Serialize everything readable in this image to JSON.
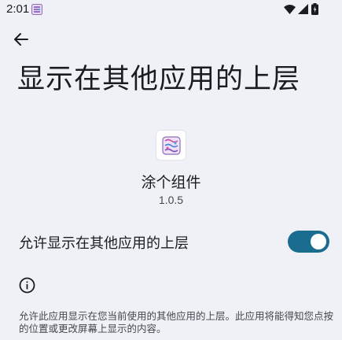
{
  "status_bar": {
    "time": "2:01",
    "icons": [
      "app-notification-icon",
      "wifi-icon",
      "signal-icon",
      "battery-icon"
    ]
  },
  "header": {
    "title": "显示在其他应用的上层",
    "back_icon": "arrow-back-icon"
  },
  "app": {
    "name": "涂个组件",
    "version": "1.0.5"
  },
  "permission": {
    "label": "允许显示在其他应用的上层",
    "enabled": true
  },
  "info": {
    "icon": "info-icon",
    "description": "允许此应用显示在您当前使用的其他应用的上层。此应用将能得知您点按的位置或更改屏幕上显示的内容。"
  },
  "colors": {
    "background": "#eff1f6",
    "toggle_track": "#1b6d8f",
    "toggle_thumb": "#ffffff"
  }
}
